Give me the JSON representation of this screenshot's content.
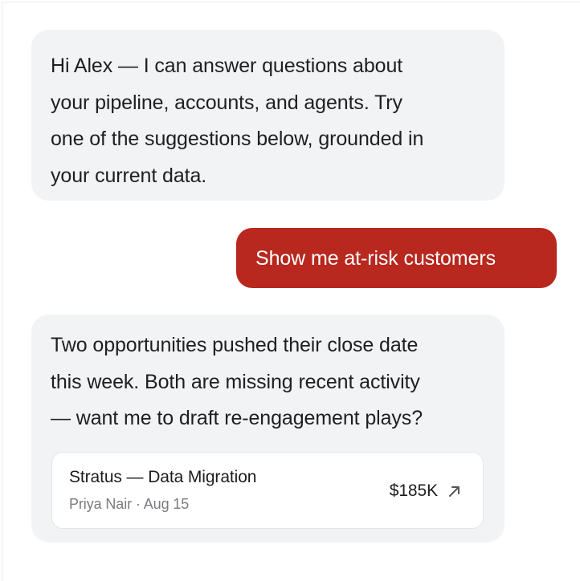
{
  "chat": {
    "messages": [
      {
        "role": "assistant",
        "lines": [
          "Hi Alex — I can answer questions about",
          "your pipeline, accounts, and agents. Try",
          "one of the suggestions below, grounded in",
          "your current data."
        ]
      },
      {
        "role": "user",
        "text": "Show me at-risk customers"
      },
      {
        "role": "assistant",
        "lines": [
          "Two opportunities pushed their close date",
          "this week. Both are missing recent activity",
          "— want me to draft re-engagement plays?"
        ],
        "card": {
          "title": "Stratus — Data Migration",
          "owner": "Priya Nair",
          "separator": "·",
          "date": "Aug 15",
          "value": "$185K",
          "icon": "arrow-up-right-icon"
        }
      }
    ]
  },
  "colors": {
    "assistant_bubble": "#f2f3f5",
    "user_bubble": "#b8281e",
    "meta_text": "#7a7b80"
  }
}
